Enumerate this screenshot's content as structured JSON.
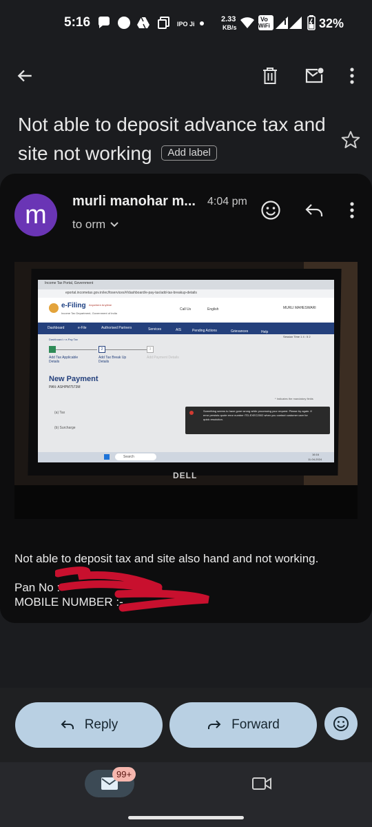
{
  "status_bar": {
    "time": "5:16",
    "app_tag": "IPO Ji",
    "net_speed_value": "2.33",
    "net_speed_unit": "KB/s",
    "vowifi_top": "Vo",
    "vowifi_bottom": "WiFi",
    "battery": "32%"
  },
  "email": {
    "subject": "Not able to deposit advance tax and site not working",
    "label_chip": "Add label",
    "sender": "murli manohar m...",
    "time": "4:04 pm",
    "avatar_letter": "m",
    "avatar_color": "#6a35b5",
    "recipient": "to orm",
    "body": "Not able to deposit tax and site also hand and not working.",
    "pan_label": "Pan No :",
    "mobile_label": "MOBILE NUMBER :-"
  },
  "photo": {
    "tab_title": "Income Tax Portal, Government",
    "url": "eportal.incometax.gov.in/iec/foservices/#/dashboard/e-pay-tax/add-tax-breakup-details",
    "brand": "e-Filing",
    "brand_sub": "Anywhere Anytime",
    "dept": "Income Tax Department, Government of India",
    "call_us": "Call Us",
    "language": "English",
    "user": "MURLI MAHESWARI",
    "nav": [
      "Dashboard",
      "e-File",
      "Authorised Partners",
      "Services",
      "AIS",
      "Pending Actions",
      "Grievances",
      "Help"
    ],
    "session": "Session Time",
    "session_time": "1 4 : 5 2",
    "breadcrumb": "Dashboard > e-Pay Tax",
    "step1": "Add Tax Applicable Details",
    "step2": "Add Tax Break Up Details",
    "step3": "Add Payment Details",
    "step2_num": "2",
    "step3_num": "3",
    "page_title": "New Payment",
    "pan_masked": "PAN: ASHPM7573M",
    "mandatory": "* Indicates the mandatory fields",
    "row_a": "(a) Tax",
    "row_b": "(b) Surcharge",
    "error": "Something seems to have gone wrong while processing your request. Please try again. If error persists quote error number ITD-EXEC2002 when you contact customer care for quick resolution.",
    "search": "Search",
    "sys_date": "11-04-2024",
    "sys_time": "16:16",
    "laptop_brand": "DELL"
  },
  "actions": {
    "reply": "Reply",
    "forward": "Forward"
  },
  "nav": {
    "mail_badge": "99+"
  },
  "colors": {
    "pill_bg": "#b9d0e3",
    "portal_nav": "#24407c",
    "error_toast": "#2a2a2a"
  }
}
